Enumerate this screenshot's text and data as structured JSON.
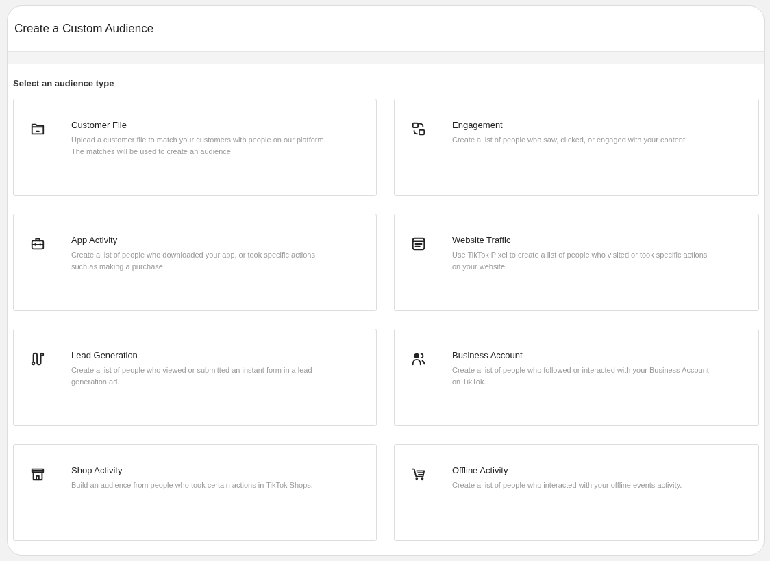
{
  "dialog": {
    "title": "Create a Custom Audience"
  },
  "section": {
    "label": "Select an audience type"
  },
  "audience_types": [
    {
      "kind": "folder",
      "title": "Customer File",
      "description": "Upload a customer file to match your customers with people on our platform. The matches will be used to create an audience."
    },
    {
      "kind": "engagement",
      "title": "Engagement",
      "description": "Create a list of people who saw, clicked, or engaged with your content."
    },
    {
      "kind": "briefcase",
      "title": "App Activity",
      "description": "Create a list of people who downloaded your app, or took specific actions, such as making a purchase."
    },
    {
      "kind": "browser",
      "title": "Website Traffic",
      "description": "Use TikTok Pixel to create a list of people who visited or took specific actions on your website."
    },
    {
      "kind": "route",
      "title": "Lead Generation",
      "description": "Create a list of people who viewed or submitted an instant form in a lead generation ad."
    },
    {
      "kind": "person",
      "title": "Business Account",
      "description": "Create a list of people who followed or interacted with your Business Account on TikTok."
    },
    {
      "kind": "store",
      "title": "Shop Activity",
      "description": "Build an audience from people who took certain actions in TikTok Shops."
    },
    {
      "kind": "cart",
      "title": "Offline Activity",
      "description": "Create a list of people who interacted with your offline events activity."
    }
  ]
}
